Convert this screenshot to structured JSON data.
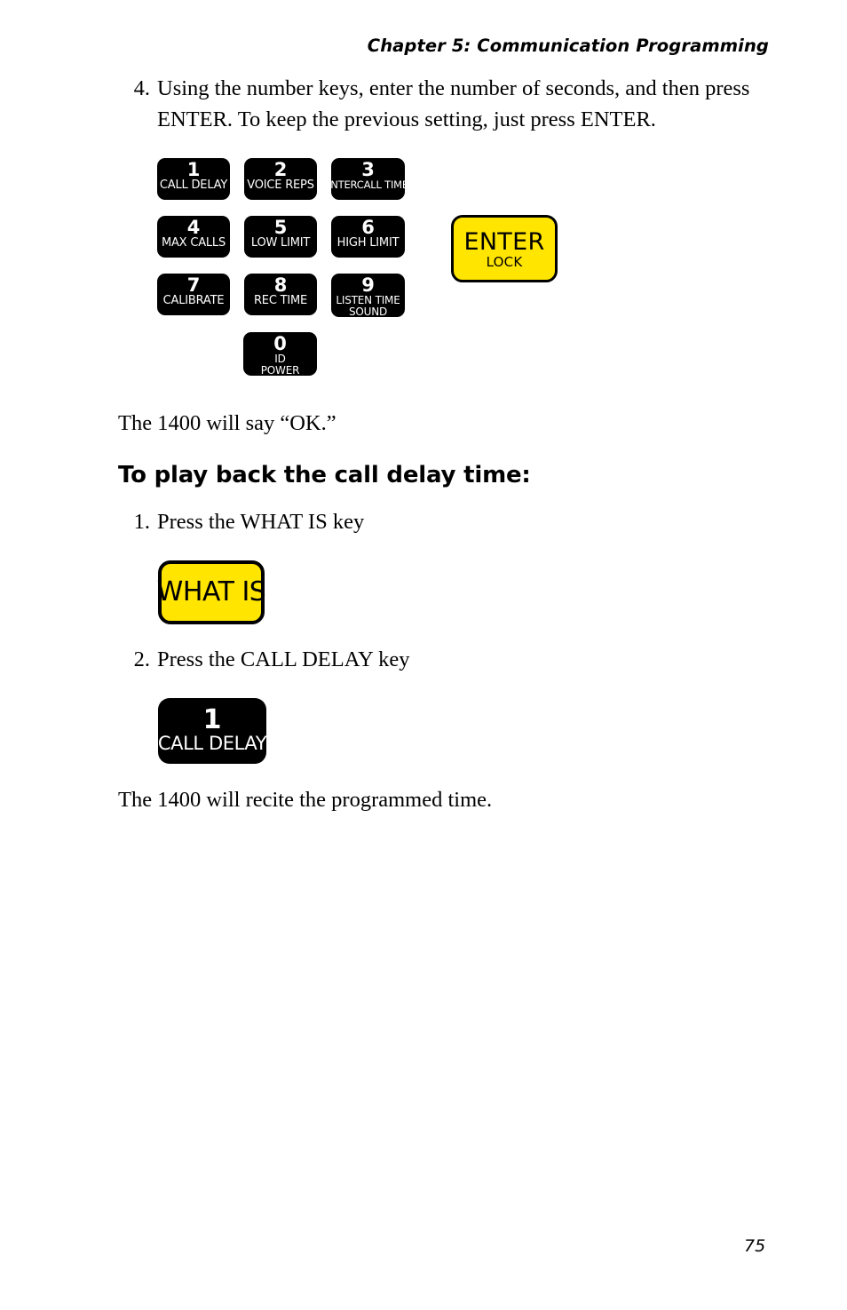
{
  "header": {
    "running_head": "Chapter 5: Communication Programming"
  },
  "steps": [
    {
      "number": "4.",
      "text": "Using the number keys, enter the number of seconds, and then press ENTER. To keep the previous setting, just press ENTER."
    }
  ],
  "keypad": {
    "rows": [
      [
        {
          "digit": "1",
          "label1": "CALL DELAY",
          "label2": ""
        },
        {
          "digit": "2",
          "label1": "VOICE REPS",
          "label2": ""
        },
        {
          "digit": "3",
          "label1": "INTERCALL TIME",
          "label2": ""
        }
      ],
      [
        {
          "digit": "4",
          "label1": "MAX CALLS",
          "label2": ""
        },
        {
          "digit": "5",
          "label1": "LOW LIMIT",
          "label2": ""
        },
        {
          "digit": "6",
          "label1": "HIGH LIMIT",
          "label2": ""
        }
      ],
      [
        {
          "digit": "7",
          "label1": "CALIBRATE",
          "label2": ""
        },
        {
          "digit": "8",
          "label1": "REC TIME",
          "label2": ""
        },
        {
          "digit": "9",
          "label1": "LISTEN TIME",
          "label2": "SOUND"
        }
      ],
      [
        {
          "digit": "0",
          "label1": "ID",
          "label2": "POWER"
        }
      ]
    ],
    "enter_key": {
      "title": "ENTER",
      "sublabel": "LOCK"
    },
    "colors": {
      "key_black": "#000000",
      "key_yellow": "#FFE500",
      "key_text": "#FFFFFF"
    }
  },
  "body": {
    "ok_line": "The 1400 will say “OK.”",
    "section_heading": "To play back the call delay time:",
    "closing_line": "The 1400 will recite the programmed time."
  },
  "playback_steps": [
    {
      "number": "1.",
      "text": "Press the WHAT IS key"
    },
    {
      "number": "2.",
      "text": "Press the CALL DELAY key"
    }
  ],
  "whatis_key": {
    "label": "WHAT IS"
  },
  "calldelay_key": {
    "digit": "1",
    "label": "CALL DELAY"
  },
  "footer": {
    "page_number": "75"
  }
}
